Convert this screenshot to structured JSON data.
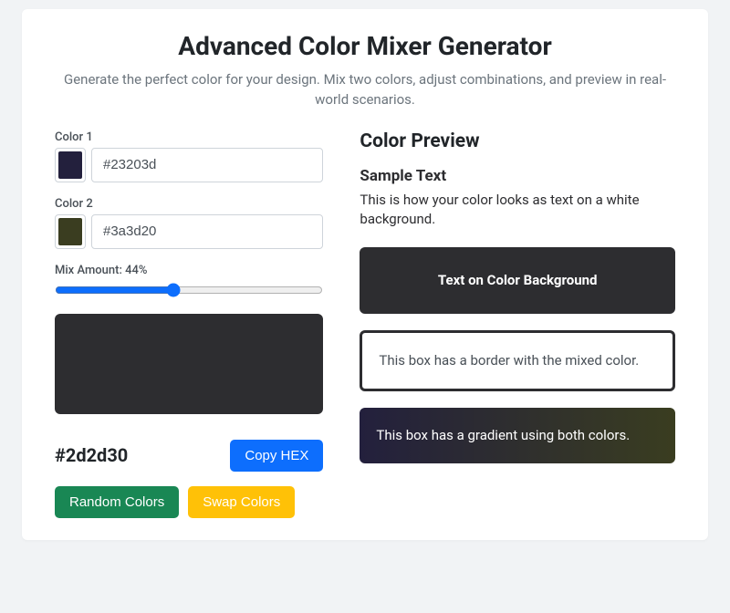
{
  "header": {
    "title": "Advanced Color Mixer Generator",
    "subtitle": "Generate the perfect color for your design. Mix two colors, adjust combinations, and preview in real-world scenarios."
  },
  "colors": {
    "color1_label": "Color 1",
    "color1_value": "#23203d",
    "color2_label": "Color 2",
    "color2_value": "#3a3d20"
  },
  "mix": {
    "label_prefix": "Mix Amount: ",
    "percent": 44,
    "label_full": "Mix Amount: 44%"
  },
  "result": {
    "hex": "#2d2d30",
    "swatch_bg": "#2d2d30"
  },
  "buttons": {
    "copy": "Copy HEX",
    "random": "Random Colors",
    "swap": "Swap Colors"
  },
  "preview": {
    "heading": "Color Preview",
    "sample_heading": "Sample Text",
    "sample_text": "This is how your color looks as text on a white background.",
    "on_color_text": "Text on Color Background",
    "border_text": "This box has a border with the mixed color.",
    "gradient_text": "This box has a gradient using both colors."
  }
}
